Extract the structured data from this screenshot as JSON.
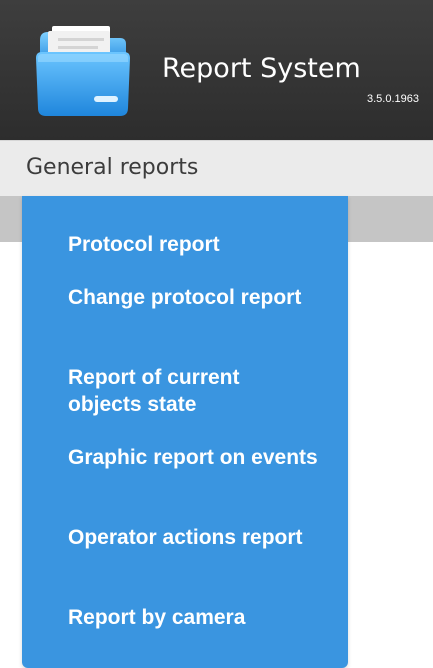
{
  "header": {
    "title": "Report System",
    "version": "3.5.0.1963",
    "logo_icon": "folder-icon"
  },
  "menubar": {
    "active_item": "General reports"
  },
  "dropdown": {
    "items": [
      {
        "label": "Protocol report"
      },
      {
        "label": "Change protocol report"
      },
      {
        "label": "Report of current objects state"
      },
      {
        "label": "Graphic report on events"
      },
      {
        "label": "Operator actions report"
      },
      {
        "label": "Report by camera"
      }
    ]
  },
  "colors": {
    "header_bg": "#333333",
    "menubar_bg": "#ebebeb",
    "subbar_bg": "#c5c5c5",
    "dropdown_bg": "#3a95e0",
    "dropdown_text": "#ffffff"
  }
}
